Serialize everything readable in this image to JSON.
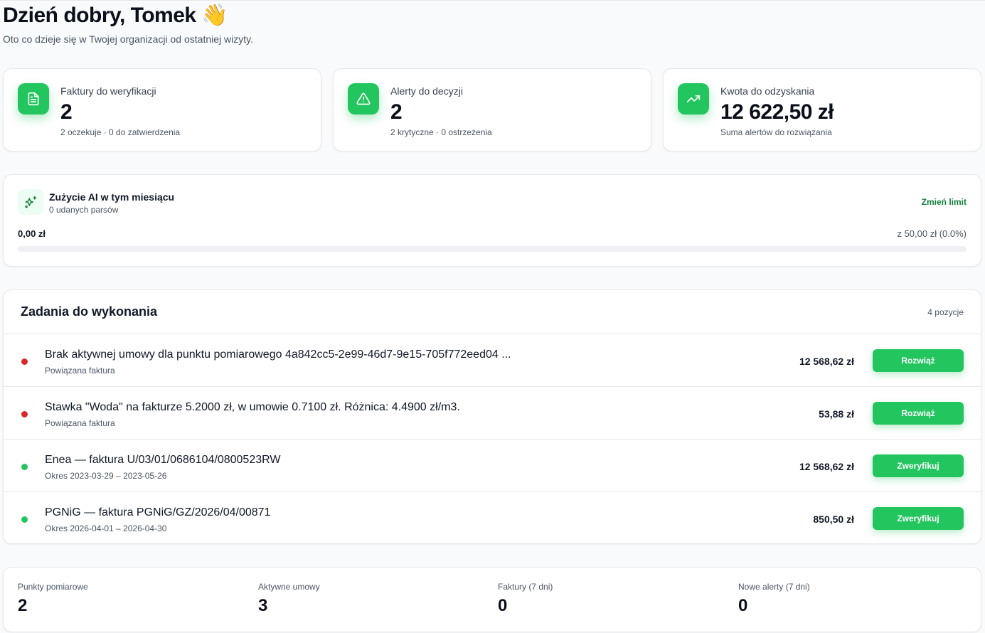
{
  "greeting": {
    "title": "Dzień dobry, Tomek 👋",
    "subtitle": "Oto co dzieje się w Twojej organizacji od ostatniej wizyty."
  },
  "stats": [
    {
      "icon": "document-icon",
      "label": "Faktury do weryfikacji",
      "value": "2",
      "sub": "2 oczekuje · 0 do zatwierdzenia"
    },
    {
      "icon": "warning-triangle-icon",
      "label": "Alerty do decyzji",
      "value": "2",
      "sub": "2 krytyczne · 0 ostrzeżenia"
    },
    {
      "icon": "trending-up-icon",
      "label": "Kwota do odzyskania",
      "value": "12 622,50 zł",
      "sub": "Suma alertów do rozwiązania"
    }
  ],
  "ai_usage": {
    "icon": "sparkles-icon",
    "title": "Zużycie AI w tym miesiącu",
    "subtitle": "0 udanych parsów",
    "change_limit": "Zmień limit",
    "used": "0,00 zł",
    "limit": "z 50,00 zł (0.0%)",
    "progress_fraction": 0.0
  },
  "tasks": {
    "title": "Zadania do wykonania",
    "count": "4 pozycje",
    "items": [
      {
        "status": "critical",
        "dot_color": "#dc2626",
        "title": "Brak aktywnej umowy dla punktu pomiarowego 4a842cc5-2e99-46d7-9e15-705f772eed04 ...",
        "meta": "Powiązana faktura",
        "amount": "12 568,62 zł",
        "action": "Rozwiąż"
      },
      {
        "status": "critical",
        "dot_color": "#dc2626",
        "title": "Stawka \"Woda\" na fakturze 5.2000 zł, w umowie 0.7100 zł. Różnica: 4.4900 zł/m3.",
        "meta": "Powiązana faktura",
        "amount": "53,88 zł",
        "action": "Rozwiąż"
      },
      {
        "status": "ok",
        "dot_color": "#22c55e",
        "title": "Enea — faktura U/03/01/0686104/0800523RW",
        "meta": "Okres 2023-03-29 – 2023-05-26",
        "amount": "12 568,62 zł",
        "action": "Zweryfikuj"
      },
      {
        "status": "ok",
        "dot_color": "#22c55e",
        "title": "PGNiG — faktura PGNiG/GZ/2026/04/00871",
        "meta": "Okres 2026-04-01 – 2026-04-30",
        "amount": "850,50 zł",
        "action": "Zweryfikuj"
      }
    ]
  },
  "summary": [
    {
      "label": "Punkty pomiarowe",
      "value": "2"
    },
    {
      "label": "Aktywne umowy",
      "value": "3"
    },
    {
      "label": "Faktury (7 dni)",
      "value": "0"
    },
    {
      "label": "Nowe alerty (7 dni)",
      "value": "0"
    }
  ],
  "colors": {
    "accent": "#22c55e",
    "link": "#15803d",
    "critical": "#dc2626"
  }
}
